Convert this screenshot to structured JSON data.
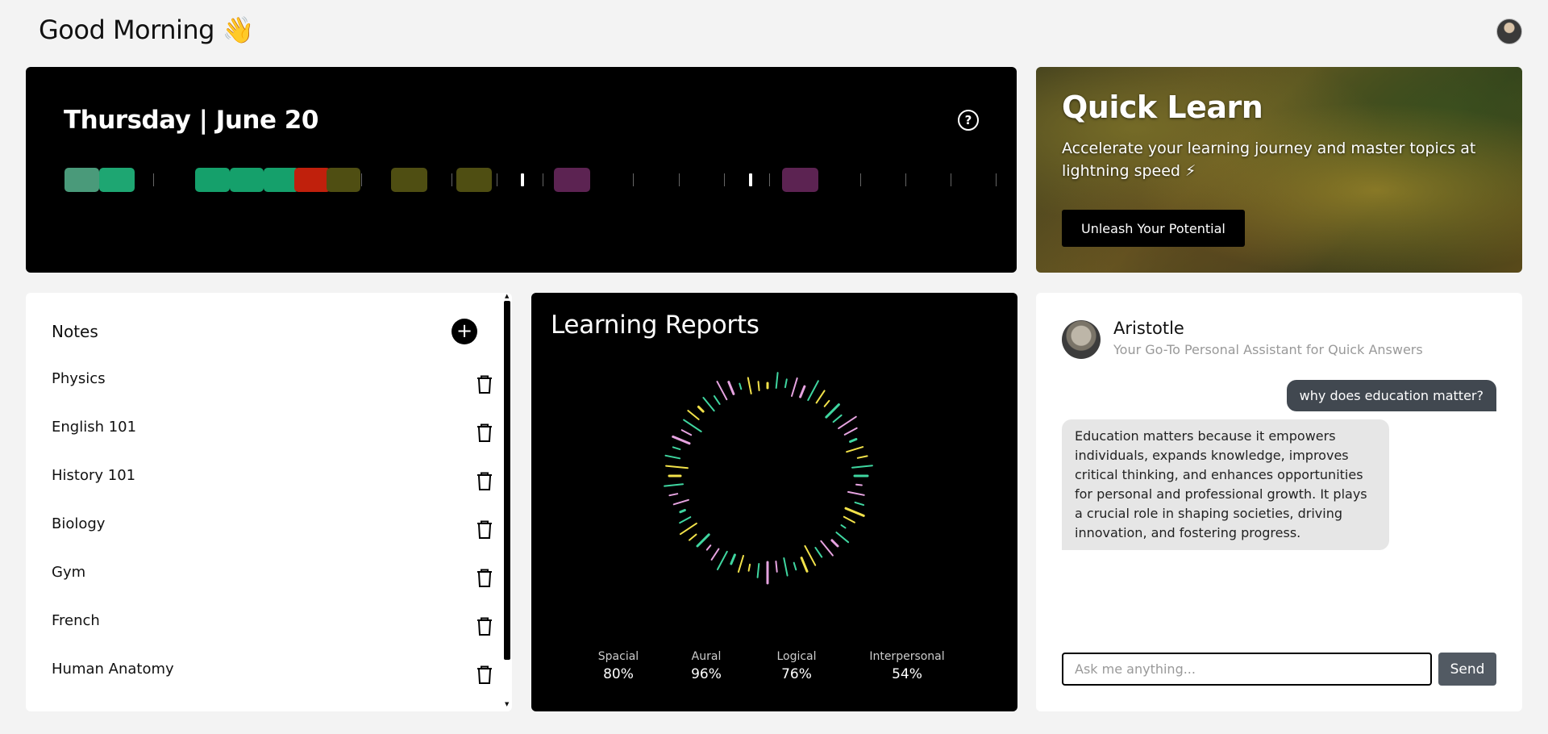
{
  "header": {
    "greeting": "Good Morning 👋"
  },
  "calendar": {
    "date_title": "Thursday | June 20",
    "help_icon": "question-circle-icon",
    "blocks": [
      {
        "color": "#4a9a7a"
      },
      {
        "color": "#1ea672"
      },
      {
        "color": "#15a06b"
      },
      {
        "color": "#15a06b"
      },
      {
        "color": "#15a06b"
      },
      {
        "color": "#c0200c"
      },
      {
        "color": "#4f4e12"
      },
      {
        "color": "#4f4e12"
      },
      {
        "color": "#4f4e12"
      },
      {
        "color": "#5c2352"
      },
      {
        "color": "#5c2352"
      }
    ]
  },
  "quick_learn": {
    "title": "Quick Learn",
    "subtitle": "Accelerate your learning journey and master topics at lightning speed ⚡",
    "button": "Unleash Your Potential"
  },
  "notes": {
    "title": "Notes",
    "add_icon": "plus-icon",
    "items": [
      {
        "label": "Physics"
      },
      {
        "label": "English 101"
      },
      {
        "label": "History 101"
      },
      {
        "label": "Biology"
      },
      {
        "label": "Gym"
      },
      {
        "label": "French"
      },
      {
        "label": "Human Anatomy"
      }
    ],
    "delete_icon": "trash-icon"
  },
  "learning_reports": {
    "title": "Learning Reports",
    "stats": [
      {
        "label": "Spacial",
        "value": "80%"
      },
      {
        "label": "Aural",
        "value": "96%"
      },
      {
        "label": "Logical",
        "value": "76%"
      },
      {
        "label": "Interpersonal",
        "value": "54%"
      }
    ],
    "colors": {
      "yellow": "#f2e24a",
      "green": "#3fd6a0",
      "pink": "#e6a3e0"
    }
  },
  "chat": {
    "bot_name": "Aristotle",
    "bot_desc": "Your Go-To Personal Assistant for Quick Answers",
    "user_message": "why does education matter?",
    "bot_message": "Education matters because it empowers individuals, expands knowledge, improves critical thinking, and enhances opportunities for personal and professional growth. It plays a crucial role in shaping societies, driving innovation, and fostering progress.",
    "input_placeholder": "Ask me anything...",
    "send_label": "Send"
  }
}
